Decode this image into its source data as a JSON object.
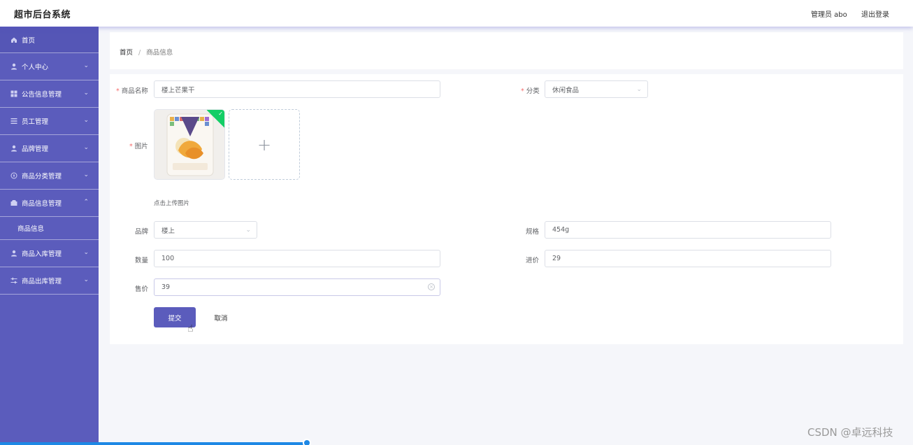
{
  "app": {
    "title": "超市后台系统"
  },
  "header": {
    "user_label": "管理员 abo",
    "logout_label": "退出登录"
  },
  "sidebar": {
    "items": [
      {
        "label": "首页",
        "icon": "home-icon",
        "arrow": ""
      },
      {
        "label": "个人中心",
        "icon": "user-icon",
        "arrow": "down"
      },
      {
        "label": "公告信息管理",
        "icon": "grid-icon",
        "arrow": "down"
      },
      {
        "label": "员工管理",
        "icon": "list-icon",
        "arrow": "down"
      },
      {
        "label": "品牌管理",
        "icon": "user-icon",
        "arrow": "down"
      },
      {
        "label": "商品分类管理",
        "icon": "compass-icon",
        "arrow": "down"
      },
      {
        "label": "商品信息管理",
        "icon": "box-icon",
        "arrow": "up"
      },
      {
        "label": "商品信息",
        "sub": true
      },
      {
        "label": "商品入库管理",
        "icon": "user-icon",
        "arrow": "down"
      },
      {
        "label": "商品出库管理",
        "icon": "sliders-icon",
        "arrow": "down"
      }
    ]
  },
  "breadcrumb": {
    "home": "首页",
    "separator": "/",
    "current": "商品信息"
  },
  "form": {
    "name": {
      "label": "商品名称",
      "value": "楼上芒果干"
    },
    "category": {
      "label": "分类",
      "value": "休闲食品"
    },
    "image": {
      "label": "图片",
      "tip": "点击上传图片"
    },
    "brand": {
      "label": "品牌",
      "value": "楼上"
    },
    "spec": {
      "label": "规格",
      "value": "454g"
    },
    "quantity": {
      "label": "数量",
      "value": "100"
    },
    "purchase_price": {
      "label": "进价",
      "value": "29"
    },
    "sale_price": {
      "label": "售价",
      "value": "39"
    },
    "submit_label": "提交",
    "cancel_label": "取消"
  },
  "watermark": "CSDN @卓远科技",
  "colors": {
    "accent": "#5b5cbc",
    "success": "#13ce66",
    "required": "#f56c6c"
  }
}
